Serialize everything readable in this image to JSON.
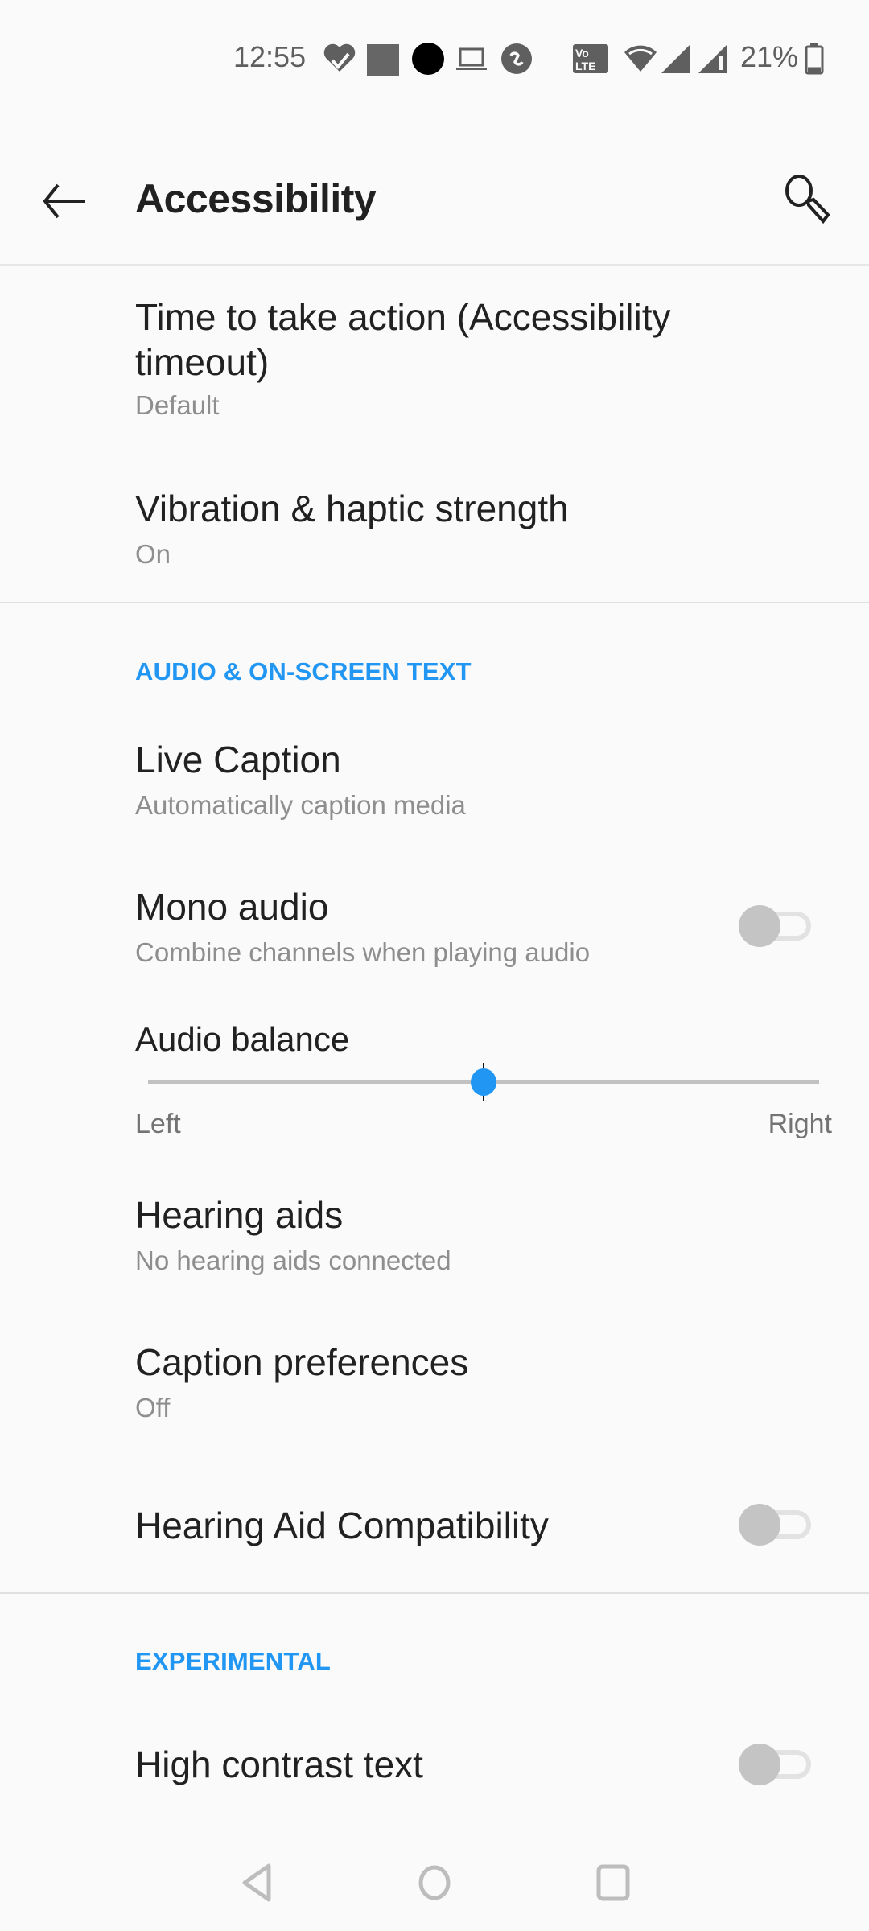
{
  "status_bar": {
    "time": "12:55",
    "left_icons": [
      "health-icon",
      "gallery-icon",
      "dot-icon",
      "laptop-icon",
      "sync-icon"
    ],
    "right_icons": [
      "volte-icon",
      "wifi-icon",
      "signal-1-icon",
      "signal-2-icon"
    ],
    "volte_label_1": "Vo",
    "volte_label_2": "LTE",
    "battery_percent": "21%",
    "battery_level": 0.21
  },
  "toolbar": {
    "title": "Accessibility",
    "back_icon": "arrow-left-icon",
    "search_icon": "search-icon"
  },
  "items_top": [
    {
      "title_line1": "Time to take action (Accessibility",
      "title_line2": "timeout)",
      "subtitle": "Default"
    },
    {
      "title": "Vibration & haptic strength",
      "subtitle": "On"
    }
  ],
  "section_audio": {
    "header": "AUDIO & ON-SCREEN TEXT",
    "live_caption": {
      "title": "Live Caption",
      "subtitle": "Automatically caption media"
    },
    "mono_audio": {
      "title": "Mono audio",
      "subtitle": "Combine channels when playing audio",
      "enabled": false
    },
    "audio_balance": {
      "title": "Audio balance",
      "left_label": "Left",
      "right_label": "Right",
      "value": 0.5
    },
    "hearing_aids": {
      "title": "Hearing aids",
      "subtitle": "No hearing aids connected"
    },
    "caption_preferences": {
      "title": "Caption preferences",
      "subtitle": "Off"
    },
    "hearing_aid_compat": {
      "title": "Hearing Aid Compatibility",
      "enabled": false
    }
  },
  "section_experimental": {
    "header": "EXPERIMENTAL",
    "high_contrast": {
      "title": "High contrast text",
      "enabled": false
    }
  },
  "nav_bar": {
    "back": "nav-back-icon",
    "home": "nav-home-icon",
    "recents": "nav-recents-icon"
  },
  "colors": {
    "accent": "#2196f3",
    "background": "#fafafa",
    "text_primary": "#212121",
    "text_secondary": "#8e8e8e",
    "toggle_off": "#c4c4c4"
  }
}
